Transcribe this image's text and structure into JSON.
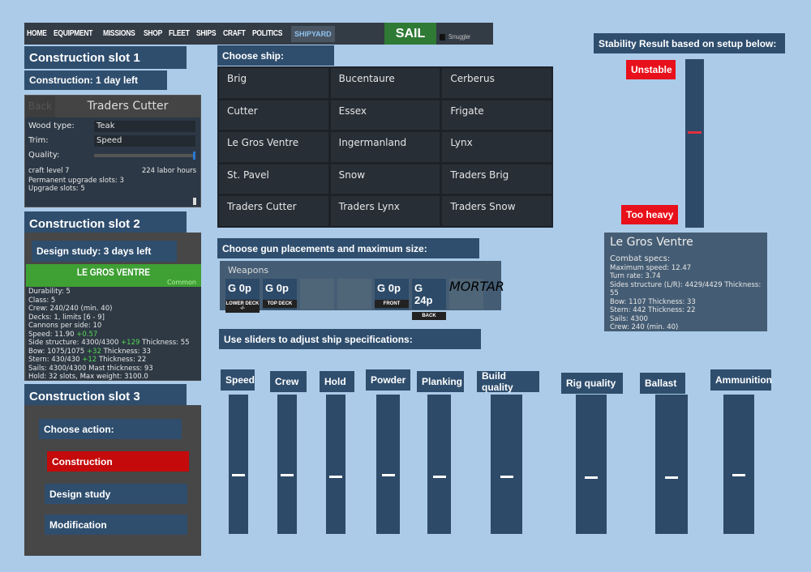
{
  "nav": {
    "items": [
      "HOME",
      "EQUIPMENT",
      "MISSIONS",
      "SHOP",
      "FLEET",
      "SHIPS",
      "CRAFT",
      "POLITICS"
    ],
    "active": "SHIPYARD",
    "sail": "SAIL",
    "smuggler": "Smuggler"
  },
  "slot1": {
    "title": "Construction slot 1",
    "status": "Construction: 1 day left",
    "back": "Back",
    "ship": "Traders Cutter",
    "wood_label": "Wood type:",
    "wood": "Teak",
    "trim_label": "Trim:",
    "trim": "Speed",
    "quality_label": "Quality:",
    "quality": 1.0,
    "craft_level": "craft level 7",
    "labor": "224 labor hours",
    "perm_slots": "Permanent upgrade slots: 3",
    "upgrade_slots": "Upgrade slots: 5"
  },
  "slot2": {
    "title": "Construction slot 2",
    "status": "Design study: 3 days left",
    "ship": "LE GROS VENTRE",
    "rarity": "Common",
    "lines": [
      [
        "Durability: 5",
        "",
        " "
      ],
      [
        "Class: 5",
        "",
        ""
      ],
      [
        "Crew: 240/240 (min. 40)",
        "",
        ""
      ],
      [
        "Decks: 1, limits [6 - 9]",
        "",
        ""
      ],
      [
        "Cannons per side: 10",
        "",
        ""
      ],
      [
        "Speed: 11.90 ",
        "+0.57",
        ""
      ],
      [
        "Side structure: 4300/4300 ",
        "+129",
        " Thickness: 55"
      ],
      [
        "Bow: 1075/1075 ",
        "+32",
        " Thickness: 33"
      ],
      [
        "Stern: 430/430 ",
        "+12",
        " Thickness: 22"
      ],
      [
        "Sails: 4300/4300 Mast thickness: 93",
        "",
        ""
      ],
      [
        "Hold: 32 slots, Max weight: 3100.0",
        "",
        ""
      ]
    ]
  },
  "slot3": {
    "title": "Construction slot 3",
    "choose": "Choose action:",
    "actions": [
      "Construction",
      "Design study",
      "Modification"
    ]
  },
  "choose_ship": {
    "title": "Choose ship:",
    "ships": [
      "Brig",
      "Bucentaure",
      "Cerberus",
      "Cutter",
      "Essex",
      "Frigate",
      "Le Gros Ventre",
      "Ingermanland",
      "Lynx",
      "St. Pavel",
      "Snow",
      "Traders Brig",
      "Traders Cutter",
      "Traders Lynx",
      "Traders Snow"
    ]
  },
  "guns": {
    "title": "Choose gun placements and maximum size:",
    "weapons": "Weapons",
    "slots": [
      {
        "value": "G  0p",
        "label": "LOWER DECK -/-"
      },
      {
        "value": "G  0p",
        "label": "TOP DECK"
      },
      {
        "value": "",
        "label": ""
      },
      {
        "value": "",
        "label": ""
      },
      {
        "value": "G  0p",
        "label": "FRONT"
      },
      {
        "value": "G 24p",
        "label": "BACK"
      },
      {
        "value": "",
        "label": "MORTAR"
      }
    ]
  },
  "sliders": {
    "title": "Use sliders to adjust ship specifications:",
    "items": [
      {
        "label": "Speed",
        "value": 0.43
      },
      {
        "label": "Crew",
        "value": 0.43
      },
      {
        "label": "Hold",
        "value": 0.42
      },
      {
        "label": "Powder",
        "value": 0.43
      },
      {
        "label": "Planking",
        "value": 0.42
      },
      {
        "label": "Build quality",
        "value": 0.42
      },
      {
        "label": "Rig quality",
        "value": 0.41
      },
      {
        "label": "Ballast",
        "value": 0.41
      },
      {
        "label": "Ammunition",
        "value": 0.43
      }
    ]
  },
  "stability": {
    "title": "Stability Result based on setup below:",
    "top": "Unstable",
    "bottom": "Too heavy",
    "value": 0.57,
    "marker_color": "#e03040"
  },
  "result": {
    "ship": "Le Gros Ventre",
    "lines": [
      "Combat specs:",
      "Maximum speed: 12.47",
      "Turn rate: 3.74",
      "Sides structure (L/R): 4429/4429 Thickness: 55",
      "Bow: 1107 Thickness: 33",
      "Stern: 442 Thickness: 22",
      "Sails: 4300",
      "Crew: 240 (min. 40)"
    ]
  }
}
